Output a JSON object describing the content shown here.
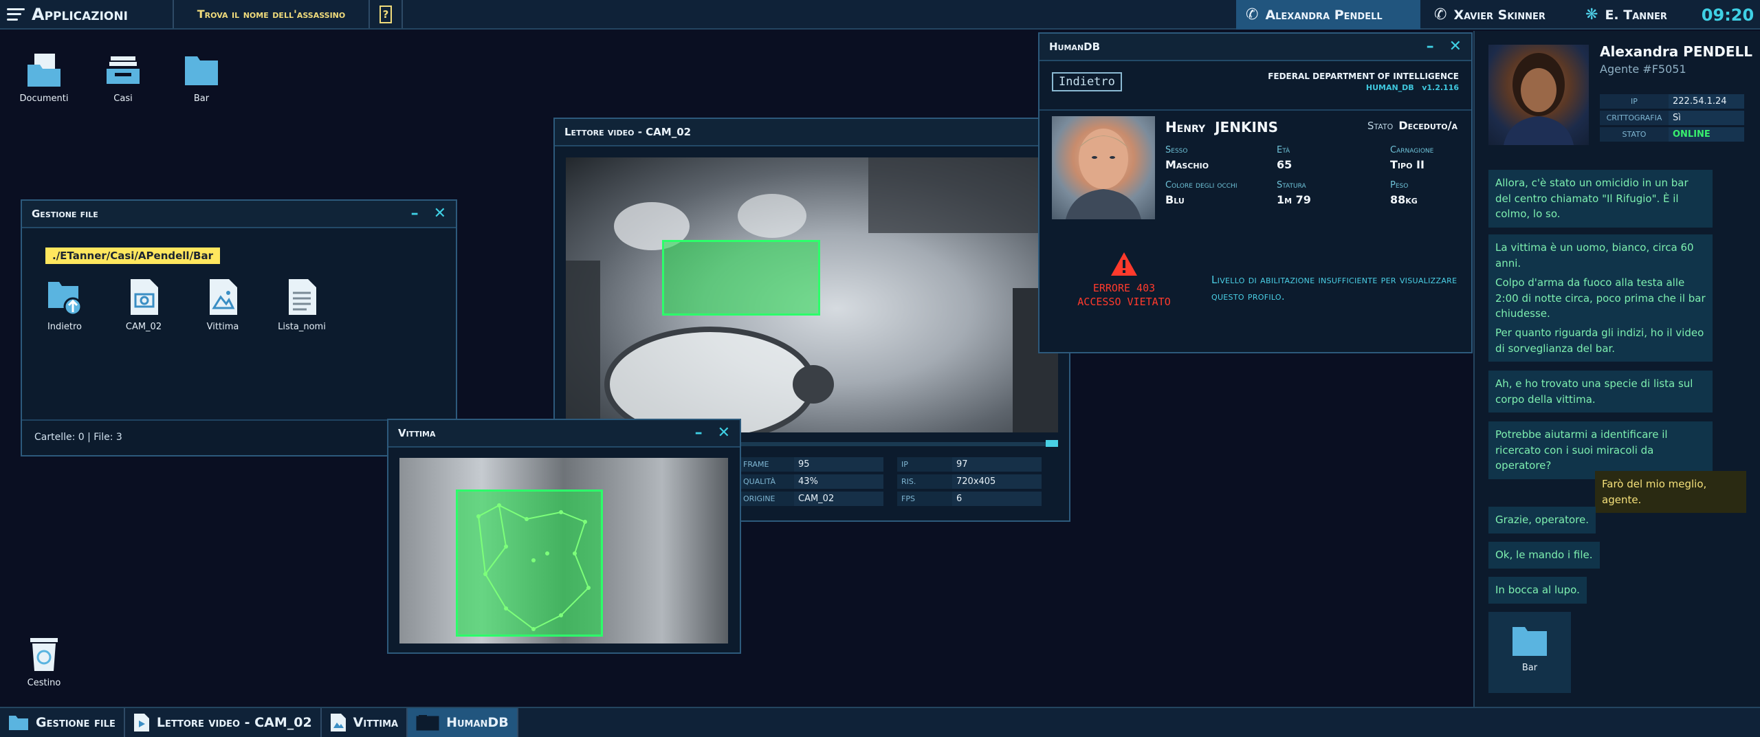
{
  "topbar": {
    "apps_label": "Applicazioni",
    "mission": "Trova il nome dell'assassino",
    "help": "?",
    "contacts": [
      "Alexandra Pendell",
      "Xavier Skinner",
      "E. Tanner"
    ],
    "clock": "09:20"
  },
  "desktop": {
    "icons": [
      "Documenti",
      "Casi",
      "Bar"
    ],
    "trash": "Cestino"
  },
  "file_manager": {
    "title": "Gestione file",
    "path": "./ETanner/Casi/APendell/Bar",
    "items": [
      "Indietro",
      "CAM_02",
      "Vittima",
      "Lista_nomi"
    ],
    "footer": "Cartelle: 0 | File: 3"
  },
  "video_player": {
    "title": "Lettore video - CAM_02",
    "meta": {
      "frame_k": "FRAME",
      "frame_v": "95",
      "ip_k": "IP",
      "ip_v": "97",
      "qual_k": "QUALITÀ",
      "qual_v": "43%",
      "ris_k": "RIS.",
      "ris_v": "720x405",
      "orig_k": "ORIGINE",
      "orig_v": "CAM_02",
      "fps_k": "FPS",
      "fps_v": "6"
    }
  },
  "victim": {
    "title": "Vittima"
  },
  "humandb": {
    "title": "HumanDB",
    "back": "Indietro",
    "org": "FEDERAL DEPARTMENT OF INTELLIGENCE",
    "app": "HUMAN_DB",
    "version": "v1.2.116",
    "first_name": "Henry",
    "last_name": "JENKINS",
    "stato_k": "Stato",
    "stato_v": "Deceduto/a",
    "sesso_k": "Sesso",
    "sesso_v": "Maschio",
    "eta_k": "Età",
    "eta_v": "65",
    "carnagione_k": "Carnagione",
    "carnagione_v": "Tipo II",
    "occhi_k": "Colore degli occhi",
    "occhi_v": "Blu",
    "statura_k": "Statura",
    "statura_v": "1m 79",
    "peso_k": "Peso",
    "peso_v": "88kg",
    "error_code": "ERRORE 403",
    "error_text": "ACCESSO VIETATO",
    "message": "Livello di abilitazione insufficiente per visualizzare questo profilo."
  },
  "chat": {
    "name": "Alexandra PENDELL",
    "agent": "Agente #F5051",
    "ip_k": "IP",
    "ip_v": "222.54.1.24",
    "crypt_k": "CRITTOGRAFIA",
    "crypt_v": "Sì",
    "stato_k": "STATO",
    "stato_v": "ONLINE",
    "messages": [
      "Allora, c'è stato un omicidio in un bar del centro chiamato \"Il Rifugio\". È il colmo, lo so.",
      "La vittima è un uomo, bianco, circa 60 anni.",
      "Colpo d'arma da fuoco alla testa alle 2:00 di notte circa, poco prima che il bar chiudesse.",
      "Per quanto riguarda gli indizi, ho il video di sorveglianza del bar.",
      "Ah, e ho trovato una specie di lista sul corpo della vittima.",
      "Potrebbe aiutarmi a identificare il ricercato con i suoi miracoli da operatore?",
      "Farò del mio meglio, agente.",
      "Grazie, operatore.",
      "Ok, le mando i file.",
      "In bocca al lupo."
    ],
    "shared_folder": "Bar"
  },
  "taskbar": [
    "Gestione file",
    "Lettore video - CAM_02",
    "Vittima",
    "HumanDB"
  ],
  "colors": {
    "accent": "#3fd0e4",
    "highlight": "#f1dc7c",
    "path": "#ffe75e",
    "error": "#ff3a2c",
    "online": "#39f06e"
  }
}
